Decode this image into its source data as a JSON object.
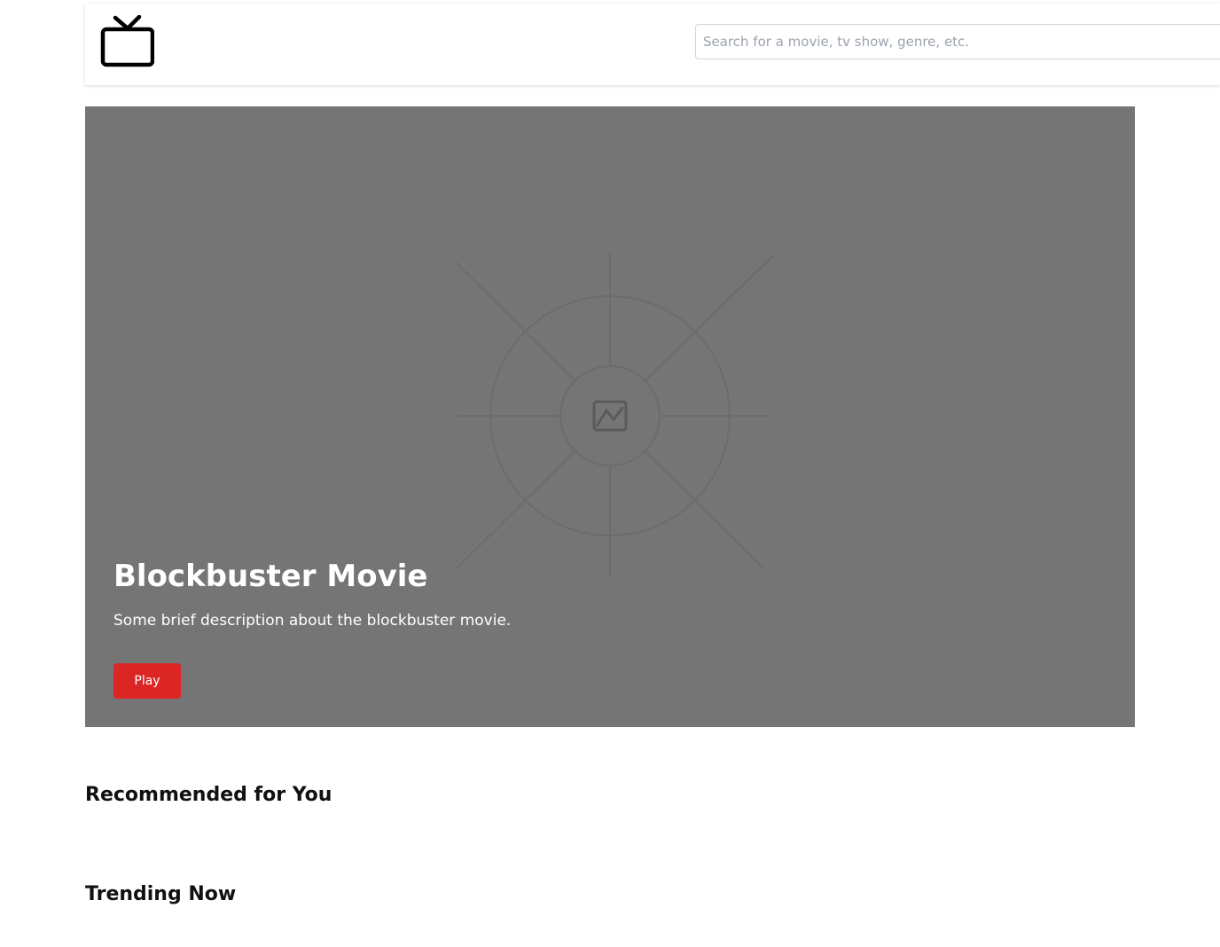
{
  "header": {
    "logo_icon": "tv-icon",
    "search": {
      "placeholder": "Search for a movie, tv show, genre, etc.",
      "value": ""
    }
  },
  "hero": {
    "image_icon": "image-placeholder-icon",
    "background_color": "#757575",
    "title": "Blockbuster Movie",
    "description": "Some brief description about the blockbuster movie.",
    "play_label": "Play",
    "play_color": "#dc2626"
  },
  "sections": {
    "recommended_title": "Recommended for You",
    "trending_title": "Trending Now"
  }
}
